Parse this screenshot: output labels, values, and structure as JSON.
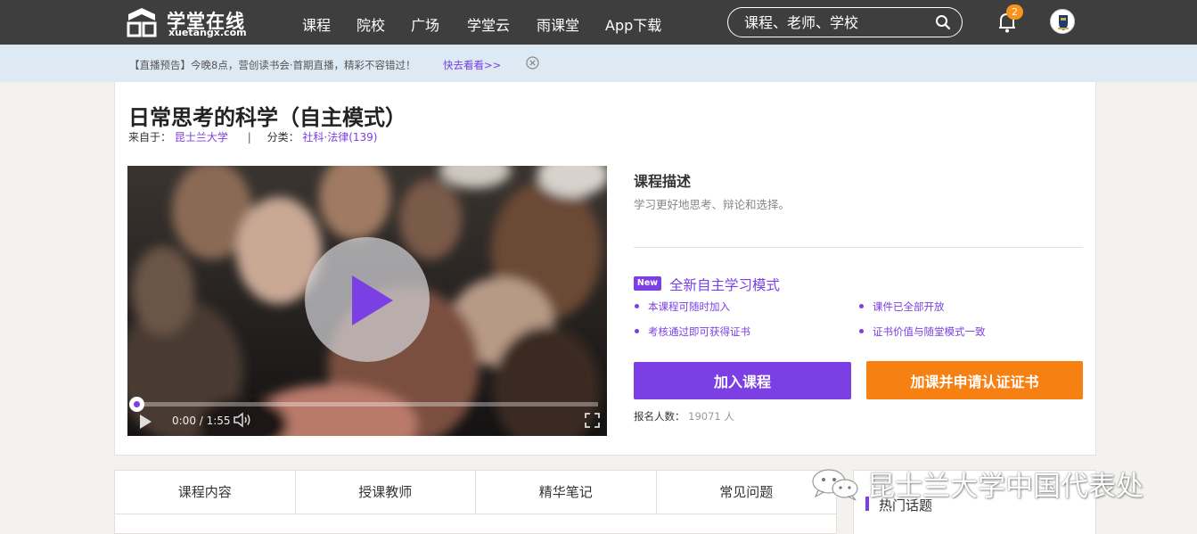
{
  "brand": {
    "name_cn": "学堂在线",
    "name_en": "xuetangx.com"
  },
  "nav": {
    "items": [
      "课程",
      "院校",
      "广场",
      "学堂云",
      "雨课堂",
      "App下载"
    ]
  },
  "search": {
    "placeholder": "课程、老师、学校"
  },
  "notifications": {
    "count": "2"
  },
  "notice": {
    "text": "【直播预告】今晚8点，营创读书会·首期直播，精彩不容错过！",
    "link": "快去看看>>"
  },
  "course": {
    "title": "日常思考的科学（自主模式）",
    "from_label": "来自于：",
    "from_value": "昆士兰大学",
    "separator": "|",
    "category_label": "分类：",
    "category_value": "社科·法律(139)"
  },
  "video": {
    "time": "0:00 / 1:55",
    "progress": 0
  },
  "description": {
    "title": "课程描述",
    "text": "学习更好地思考、辩论和选择。"
  },
  "mode": {
    "tag": "New",
    "title": "全新自主学习模式",
    "features": [
      "本课程可随时加入",
      "课件已全部开放",
      "考核通过即可获得证书",
      "证书价值与随堂模式一致"
    ]
  },
  "actions": {
    "join": "加入课程",
    "certificate": "加课并申请认证证书"
  },
  "enrollment": {
    "label": "报名人数：",
    "count": "19071 人"
  },
  "tabs": [
    "课程内容",
    "授课教师",
    "精华笔记",
    "常见问题"
  ],
  "sidebar": {
    "hot_title": "热门话题"
  },
  "watermark": {
    "text": "昆士兰大学中国代表处"
  },
  "colors": {
    "accent": "#7b3fe4",
    "orange": "#f78012",
    "topbar": "#3e3e3e",
    "notice_bg": "#dde9f3"
  }
}
